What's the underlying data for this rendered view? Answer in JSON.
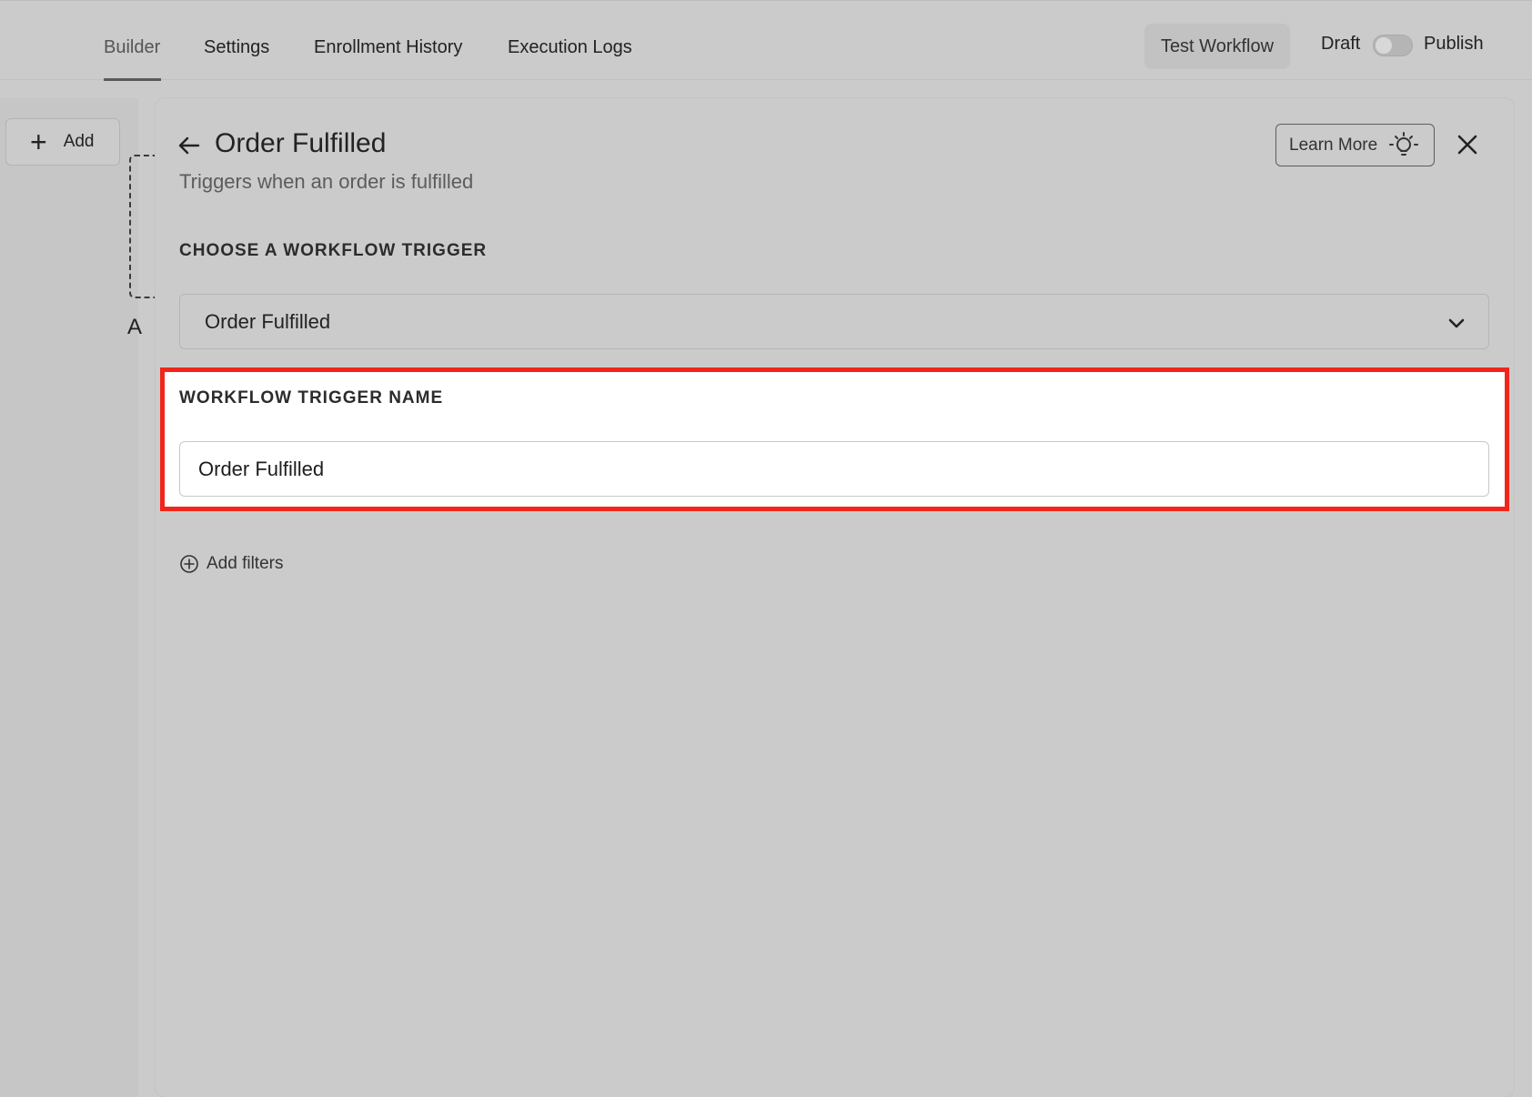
{
  "nav": {
    "tabs": [
      {
        "label": "Builder",
        "active": true
      },
      {
        "label": "Settings",
        "active": false
      },
      {
        "label": "Enrollment History",
        "active": false
      },
      {
        "label": "Execution Logs",
        "active": false
      }
    ],
    "test_button": "Test Workflow",
    "draft_label": "Draft",
    "publish_label": "Publish",
    "publish_toggle_on": false
  },
  "sidebar": {
    "add_label": "Add",
    "node_letter_partial": "A"
  },
  "panel": {
    "title": "Order Fulfilled",
    "subtitle": "Triggers when an order is fulfilled",
    "learn_more_label": "Learn More",
    "trigger_section_label": "CHOOSE A WORKFLOW TRIGGER",
    "trigger_selected": "Order Fulfilled",
    "name_section_label": "WORKFLOW TRIGGER NAME",
    "name_value": "Order Fulfilled",
    "add_filters_label": "Add filters"
  },
  "colors": {
    "highlight_border": "#f0261b",
    "background": "#cbcbcb"
  },
  "icons": [
    "plus-icon",
    "back-arrow-icon",
    "lightbulb-icon",
    "close-icon",
    "chevron-down-icon",
    "plus-circle-icon"
  ]
}
